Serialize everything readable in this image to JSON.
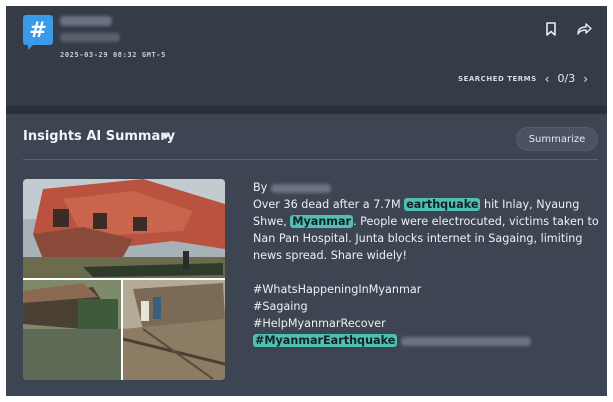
{
  "header": {
    "logo_glyph": "#",
    "timestamp": "2025-03-29 08:32 GMT-5",
    "icons": {
      "bookmark": "bookmark-icon",
      "share": "share-icon"
    }
  },
  "search_terms": {
    "label": "SEARCHED TERMS",
    "prev": "‹",
    "next": "›",
    "count": "0/3"
  },
  "panel": {
    "title": "Insights AI Summary",
    "summarize_label": "Summarize"
  },
  "post": {
    "by_label": "By",
    "text_1": "Over 36 dead after a 7.7M ",
    "highlight_1": "earthquake",
    "text_2": " hit Inlay, Nyaung Shwe, ",
    "highlight_2": "Myanmar",
    "text_3": ". People were electrocuted, victims taken to Nan Pan Hospital. Junta blocks internet in Sagaing, limiting news spread. Share widely!",
    "hashtags": [
      "#WhatsHappeningInMyanmar",
      "#Sagaing",
      "#HelpMyanmarRecover"
    ],
    "highlight_hashtag": "#MyanmarEarthquake"
  },
  "colors": {
    "accent": "#3b9be9",
    "highlight": "#4fbfb1",
    "panel_bg": "#3d4452",
    "header_bg": "#353b47"
  }
}
